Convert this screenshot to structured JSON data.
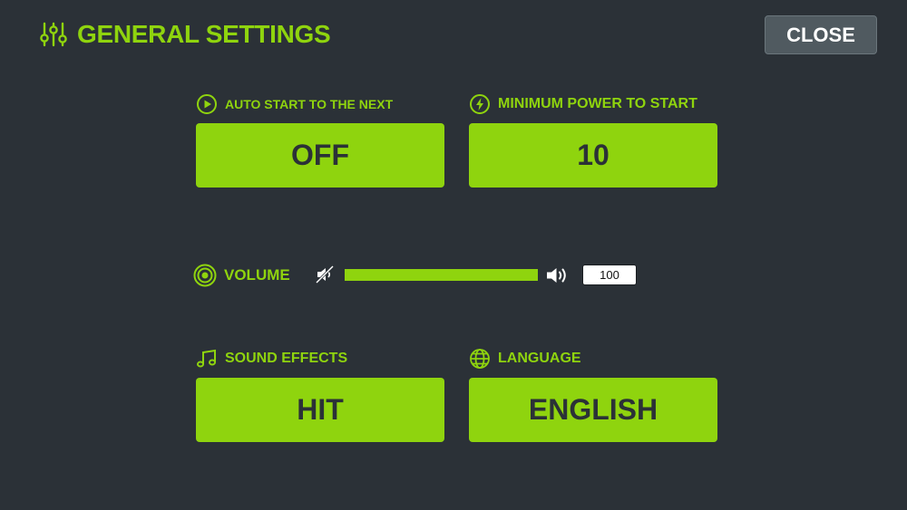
{
  "header": {
    "title": "GENERAL SETTINGS",
    "icon": "sliders-icon",
    "close_label": "CLOSE"
  },
  "settings": {
    "auto_start": {
      "label": "AUTO START TO THE NEXT",
      "value": "OFF",
      "icon": "play-circle-icon"
    },
    "min_power": {
      "label": "MINIMUM POWER TO START",
      "value": "10",
      "icon": "lightning-circle-icon"
    },
    "sound_effects": {
      "label": "SOUND EFFECTS",
      "value": "HIT",
      "icon": "music-note-icon"
    },
    "language": {
      "label": "LANGUAGE",
      "value": "ENGLISH",
      "icon": "globe-icon"
    }
  },
  "volume": {
    "label": "VOLUME",
    "value": "100",
    "level_percent": 100,
    "icon": "target-icon",
    "min_icon": "mute-icon",
    "max_icon": "speaker-icon"
  },
  "colors": {
    "background": "#2b3137",
    "accent": "#8fd40e",
    "close_button": "#505a60"
  }
}
